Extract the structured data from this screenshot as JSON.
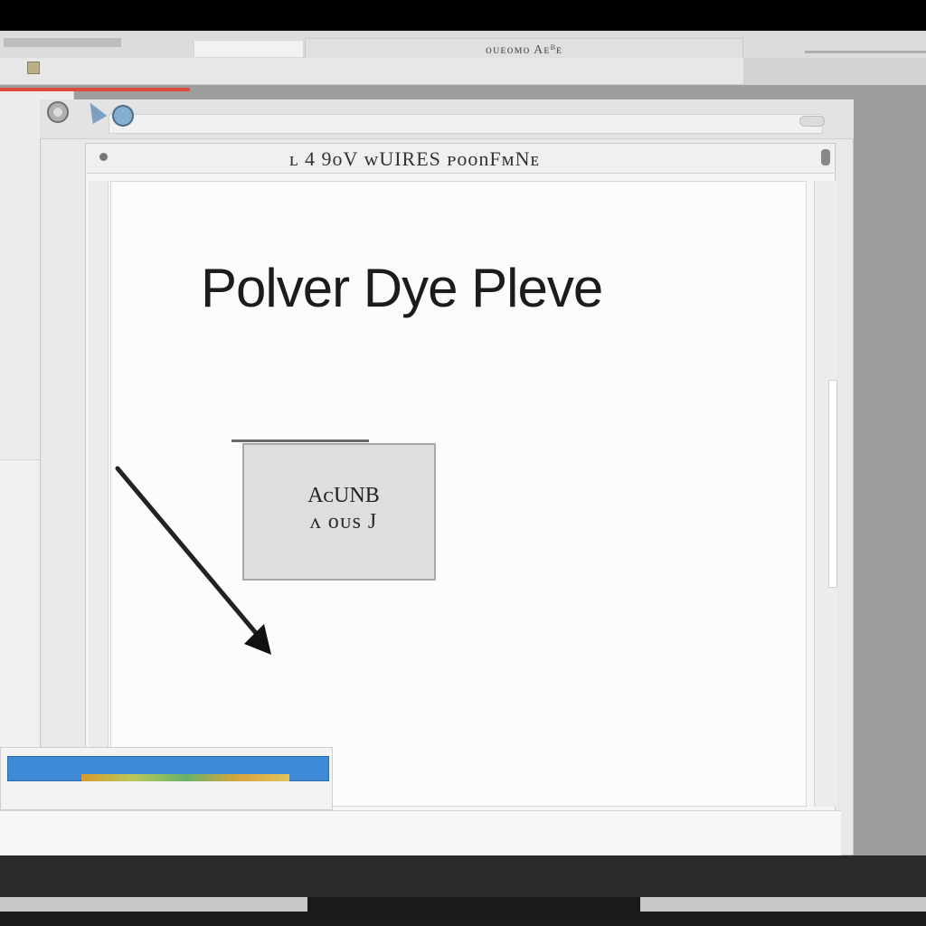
{
  "top_bar": {
    "tab_text": "ᴏᴜᴇᴏᴍᴏ  Aᴇᴮᴇ"
  },
  "document": {
    "title": "ʟ 4 9ᴏV  ᴡUIRES ᴘᴏᴏnFᴍNᴇ"
  },
  "canvas": {
    "heading": "Polver Dye Plеve"
  },
  "callout": {
    "title": "AᴄUNB",
    "subtitle": "ᴧ ᴏᴜs J"
  },
  "colors": {
    "accent_red": "#e04b3a",
    "taskbar_blue": "#3e8ad6"
  }
}
